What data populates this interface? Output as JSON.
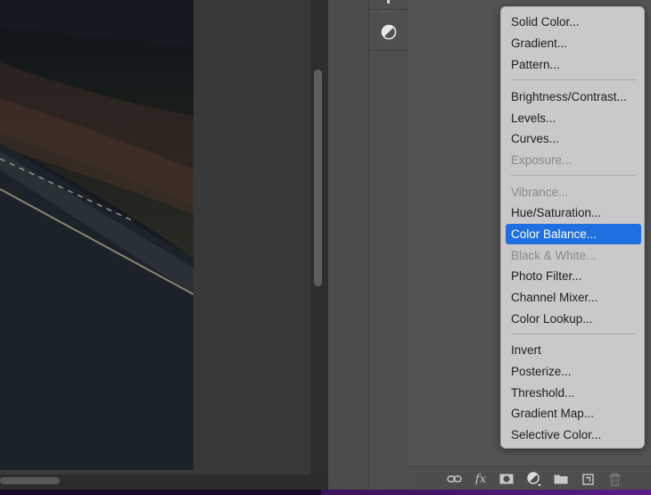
{
  "adjustment_menu": {
    "groups": [
      [
        {
          "label": "Solid Color...",
          "enabled": true
        },
        {
          "label": "Gradient...",
          "enabled": true
        },
        {
          "label": "Pattern...",
          "enabled": true
        }
      ],
      [
        {
          "label": "Brightness/Contrast...",
          "enabled": true
        },
        {
          "label": "Levels...",
          "enabled": true
        },
        {
          "label": "Curves...",
          "enabled": true
        },
        {
          "label": "Exposure...",
          "enabled": false
        }
      ],
      [
        {
          "label": "Vibrance...",
          "enabled": false
        },
        {
          "label": "Hue/Saturation...",
          "enabled": true
        },
        {
          "label": "Color Balance...",
          "enabled": true,
          "selected": true
        },
        {
          "label": "Black & White...",
          "enabled": false
        },
        {
          "label": "Photo Filter...",
          "enabled": true
        },
        {
          "label": "Channel Mixer...",
          "enabled": true
        },
        {
          "label": "Color Lookup...",
          "enabled": true
        }
      ],
      [
        {
          "label": "Invert",
          "enabled": true
        },
        {
          "label": "Posterize...",
          "enabled": true
        },
        {
          "label": "Threshold...",
          "enabled": true
        },
        {
          "label": "Gradient Map...",
          "enabled": true
        },
        {
          "label": "Selective Color...",
          "enabled": true
        }
      ]
    ]
  },
  "layers_footer": {
    "icons": [
      "link-layers-icon",
      "fx-icon",
      "layer-mask-icon",
      "adjustment-layer-icon",
      "new-group-folder-icon",
      "new-layer-icon",
      "trash-icon"
    ],
    "fx_label": "fx"
  },
  "side_tool": {
    "icon": "adjustments-icon"
  },
  "colors": {
    "selected_accent": "#1f6fe0",
    "menu_background": "#c9c9cb",
    "panel_background": "#535353",
    "bottom_accent": "#5a1d8a"
  }
}
